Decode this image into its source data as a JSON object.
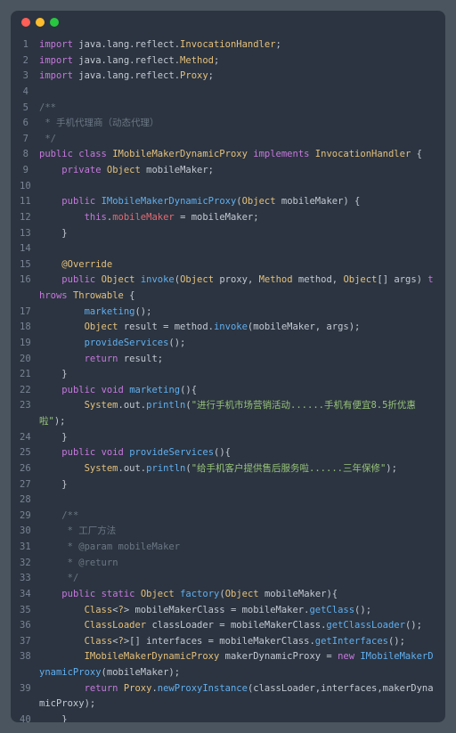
{
  "window": {
    "dots": [
      "red",
      "yellow",
      "green"
    ]
  },
  "code": {
    "lines": [
      {
        "n": 1,
        "tokens": [
          [
            "kw",
            "import"
          ],
          [
            "def",
            " java.lang.reflect."
          ],
          [
            "cls",
            "InvocationHandler"
          ],
          [
            "def",
            ";"
          ]
        ]
      },
      {
        "n": 2,
        "tokens": [
          [
            "kw",
            "import"
          ],
          [
            "def",
            " java.lang.reflect."
          ],
          [
            "cls",
            "Method"
          ],
          [
            "def",
            ";"
          ]
        ]
      },
      {
        "n": 3,
        "tokens": [
          [
            "kw",
            "import"
          ],
          [
            "def",
            " java.lang.reflect."
          ],
          [
            "cls",
            "Proxy"
          ],
          [
            "def",
            ";"
          ]
        ]
      },
      {
        "n": 4,
        "tokens": []
      },
      {
        "n": 5,
        "tokens": [
          [
            "cmt",
            "/**"
          ]
        ]
      },
      {
        "n": 6,
        "tokens": [
          [
            "cmt",
            " * 手机代理商（动态代理）"
          ]
        ]
      },
      {
        "n": 7,
        "tokens": [
          [
            "cmt",
            " */"
          ]
        ]
      },
      {
        "n": 8,
        "tokens": [
          [
            "kw",
            "public"
          ],
          [
            "def",
            " "
          ],
          [
            "kw",
            "class"
          ],
          [
            "def",
            " "
          ],
          [
            "cls",
            "IMobileMakerDynamicProxy"
          ],
          [
            "def",
            " "
          ],
          [
            "kw",
            "implements"
          ],
          [
            "def",
            " "
          ],
          [
            "cls",
            "InvocationHandler"
          ],
          [
            "def",
            " {"
          ]
        ]
      },
      {
        "n": 9,
        "tokens": [
          [
            "def",
            "    "
          ],
          [
            "kw",
            "private"
          ],
          [
            "def",
            " "
          ],
          [
            "cls",
            "Object"
          ],
          [
            "def",
            " mobileMaker;"
          ]
        ]
      },
      {
        "n": 10,
        "tokens": []
      },
      {
        "n": 11,
        "tokens": [
          [
            "def",
            "    "
          ],
          [
            "kw",
            "public"
          ],
          [
            "def",
            " "
          ],
          [
            "fn",
            "IMobileMakerDynamicProxy"
          ],
          [
            "def",
            "("
          ],
          [
            "cls",
            "Object"
          ],
          [
            "def",
            " mobileMaker) {"
          ]
        ]
      },
      {
        "n": 12,
        "tokens": [
          [
            "def",
            "        "
          ],
          [
            "kw",
            "this"
          ],
          [
            "def",
            "."
          ],
          [
            "field",
            "mobileMaker"
          ],
          [
            "def",
            " = mobileMaker;"
          ]
        ]
      },
      {
        "n": 13,
        "tokens": [
          [
            "def",
            "    }"
          ]
        ]
      },
      {
        "n": 14,
        "tokens": []
      },
      {
        "n": 15,
        "tokens": [
          [
            "def",
            "    "
          ],
          [
            "ann",
            "@Override"
          ]
        ]
      },
      {
        "n": 16,
        "tokens": [
          [
            "def",
            "    "
          ],
          [
            "kw",
            "public"
          ],
          [
            "def",
            " "
          ],
          [
            "cls",
            "Object"
          ],
          [
            "def",
            " "
          ],
          [
            "fn",
            "invoke"
          ],
          [
            "def",
            "("
          ],
          [
            "cls",
            "Object"
          ],
          [
            "def",
            " proxy, "
          ],
          [
            "cls",
            "Method"
          ],
          [
            "def",
            " method, "
          ],
          [
            "cls",
            "Object"
          ],
          [
            "def",
            "[] args) "
          ],
          [
            "kw",
            "throws"
          ],
          [
            "def",
            " "
          ],
          [
            "cls",
            "Throwable"
          ],
          [
            "def",
            " {"
          ]
        ]
      },
      {
        "n": 17,
        "tokens": [
          [
            "def",
            "        "
          ],
          [
            "fn",
            "marketing"
          ],
          [
            "def",
            "();"
          ]
        ]
      },
      {
        "n": 18,
        "tokens": [
          [
            "def",
            "        "
          ],
          [
            "cls",
            "Object"
          ],
          [
            "def",
            " result = method."
          ],
          [
            "fn",
            "invoke"
          ],
          [
            "def",
            "(mobileMaker, args);"
          ]
        ]
      },
      {
        "n": 19,
        "tokens": [
          [
            "def",
            "        "
          ],
          [
            "fn",
            "provideServices"
          ],
          [
            "def",
            "();"
          ]
        ]
      },
      {
        "n": 20,
        "tokens": [
          [
            "def",
            "        "
          ],
          [
            "kw",
            "return"
          ],
          [
            "def",
            " result;"
          ]
        ]
      },
      {
        "n": 21,
        "tokens": [
          [
            "def",
            "    }"
          ]
        ]
      },
      {
        "n": 22,
        "tokens": [
          [
            "def",
            "    "
          ],
          [
            "kw",
            "public"
          ],
          [
            "def",
            " "
          ],
          [
            "kw",
            "void"
          ],
          [
            "def",
            " "
          ],
          [
            "fn",
            "marketing"
          ],
          [
            "def",
            "(){"
          ]
        ]
      },
      {
        "n": 23,
        "tokens": [
          [
            "def",
            "        "
          ],
          [
            "cls",
            "System"
          ],
          [
            "def",
            ".out."
          ],
          [
            "fn",
            "println"
          ],
          [
            "def",
            "("
          ],
          [
            "str",
            "\"进行手机市场营销活动......手机有便宜8.5折优惠啦\""
          ],
          [
            "def",
            ");"
          ]
        ]
      },
      {
        "n": 24,
        "tokens": [
          [
            "def",
            "    }"
          ]
        ]
      },
      {
        "n": 25,
        "tokens": [
          [
            "def",
            "    "
          ],
          [
            "kw",
            "public"
          ],
          [
            "def",
            " "
          ],
          [
            "kw",
            "void"
          ],
          [
            "def",
            " "
          ],
          [
            "fn",
            "provideServices"
          ],
          [
            "def",
            "(){"
          ]
        ]
      },
      {
        "n": 26,
        "tokens": [
          [
            "def",
            "        "
          ],
          [
            "cls",
            "System"
          ],
          [
            "def",
            ".out."
          ],
          [
            "fn",
            "println"
          ],
          [
            "def",
            "("
          ],
          [
            "str",
            "\"给手机客户提供售后服务啦......三年保修\""
          ],
          [
            "def",
            ");"
          ]
        ]
      },
      {
        "n": 27,
        "tokens": [
          [
            "def",
            "    }"
          ]
        ]
      },
      {
        "n": 28,
        "tokens": []
      },
      {
        "n": 29,
        "tokens": [
          [
            "def",
            "    "
          ],
          [
            "cmt",
            "/**"
          ]
        ]
      },
      {
        "n": 30,
        "tokens": [
          [
            "def",
            "    "
          ],
          [
            "cmt",
            " * 工厂方法"
          ]
        ]
      },
      {
        "n": 31,
        "tokens": [
          [
            "def",
            "    "
          ],
          [
            "cmt",
            " * @param mobileMaker"
          ]
        ]
      },
      {
        "n": 32,
        "tokens": [
          [
            "def",
            "    "
          ],
          [
            "cmt",
            " * @return"
          ]
        ]
      },
      {
        "n": 33,
        "tokens": [
          [
            "def",
            "    "
          ],
          [
            "cmt",
            " */"
          ]
        ]
      },
      {
        "n": 34,
        "tokens": [
          [
            "def",
            "    "
          ],
          [
            "kw",
            "public"
          ],
          [
            "def",
            " "
          ],
          [
            "kw",
            "static"
          ],
          [
            "def",
            " "
          ],
          [
            "cls",
            "Object"
          ],
          [
            "def",
            " "
          ],
          [
            "fn",
            "factory"
          ],
          [
            "def",
            "("
          ],
          [
            "cls",
            "Object"
          ],
          [
            "def",
            " mobileMaker){"
          ]
        ]
      },
      {
        "n": 35,
        "tokens": [
          [
            "def",
            "        "
          ],
          [
            "cls",
            "Class"
          ],
          [
            "def",
            "<"
          ],
          [
            "cls",
            "?"
          ],
          [
            "def",
            "> mobileMakerClass = mobileMaker."
          ],
          [
            "fn",
            "getClass"
          ],
          [
            "def",
            "();"
          ]
        ]
      },
      {
        "n": 36,
        "tokens": [
          [
            "def",
            "        "
          ],
          [
            "cls",
            "ClassLoader"
          ],
          [
            "def",
            " classLoader = mobileMakerClass."
          ],
          [
            "fn",
            "getClassLoader"
          ],
          [
            "def",
            "();"
          ]
        ]
      },
      {
        "n": 37,
        "tokens": [
          [
            "def",
            "        "
          ],
          [
            "cls",
            "Class"
          ],
          [
            "def",
            "<"
          ],
          [
            "cls",
            "?"
          ],
          [
            "def",
            ">[] interfaces = mobileMakerClass."
          ],
          [
            "fn",
            "getInterfaces"
          ],
          [
            "def",
            "();"
          ]
        ]
      },
      {
        "n": 38,
        "tokens": [
          [
            "def",
            "        "
          ],
          [
            "cls",
            "IMobileMakerDynamicProxy"
          ],
          [
            "def",
            " makerDynamicProxy = "
          ],
          [
            "kw",
            "new"
          ],
          [
            "def",
            " "
          ],
          [
            "fn",
            "IMobileMakerDynamicProxy"
          ],
          [
            "def",
            "(mobileMaker);"
          ]
        ]
      },
      {
        "n": 39,
        "tokens": [
          [
            "def",
            "        "
          ],
          [
            "kw",
            "return"
          ],
          [
            "def",
            " "
          ],
          [
            "cls",
            "Proxy"
          ],
          [
            "def",
            "."
          ],
          [
            "fn",
            "newProxyInstance"
          ],
          [
            "def",
            "(classLoader,interfaces,makerDynamicProxy);"
          ]
        ]
      },
      {
        "n": 40,
        "tokens": [
          [
            "def",
            "    }"
          ]
        ]
      }
    ]
  }
}
